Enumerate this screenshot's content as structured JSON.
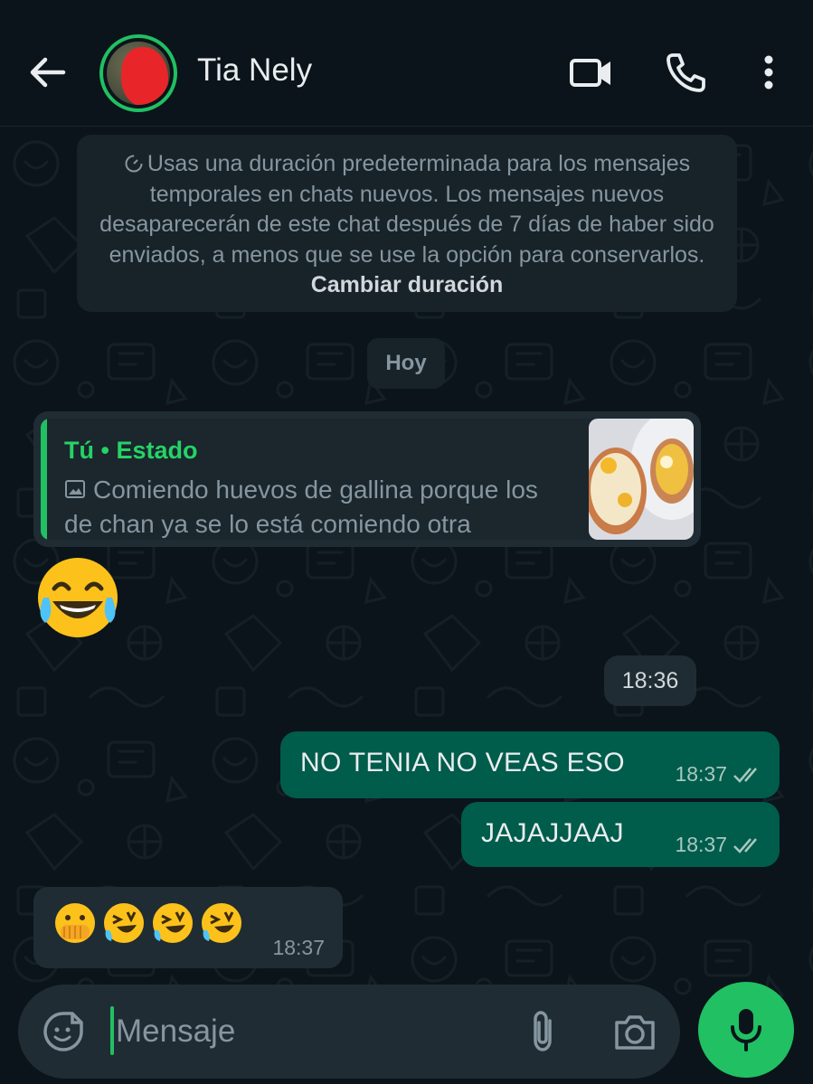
{
  "header": {
    "contact_name": "Tia Nely",
    "icons": [
      "back-arrow-icon",
      "avatar",
      "video-call-icon",
      "phone-icon",
      "more-options-icon"
    ]
  },
  "system_note": {
    "text": "Usas una duración predeterminada para los mensajes temporales en chats nuevos. Los mensajes nuevos desaparecerán de este chat después de 7 días de haber sido enviados, a menos que se use la opción para conservarlos.",
    "link": "Cambiar duración"
  },
  "date_chip": "Hoy",
  "messages": [
    {
      "direction": "incoming",
      "reply": {
        "title": "Tú • Estado",
        "text": "Comiendo huevos de gallina porque los de chan ya se lo está comiendo otra"
      },
      "emoji": "face-with-tears-of-joy",
      "time_chip": "18:36"
    },
    {
      "direction": "outgoing",
      "text": "NO TENIA NO VEAS ESO",
      "time": "18:37",
      "status": "read"
    },
    {
      "direction": "outgoing",
      "text": "JAJAJJAAJ",
      "time": "18:37",
      "status": "read"
    },
    {
      "direction": "incoming",
      "emojis": [
        "face-with-open-eyes-and-hand-over-mouth",
        "rolling-on-the-floor-laughing",
        "rolling-on-the-floor-laughing",
        "rolling-on-the-floor-laughing"
      ],
      "time": "18:37"
    }
  ],
  "composer": {
    "placeholder": "Mensaje"
  },
  "colors": {
    "background": "#0b141a",
    "incoming_bubble": "#202c33",
    "outgoing_bubble": "#005c4b",
    "accent": "#21c063"
  }
}
